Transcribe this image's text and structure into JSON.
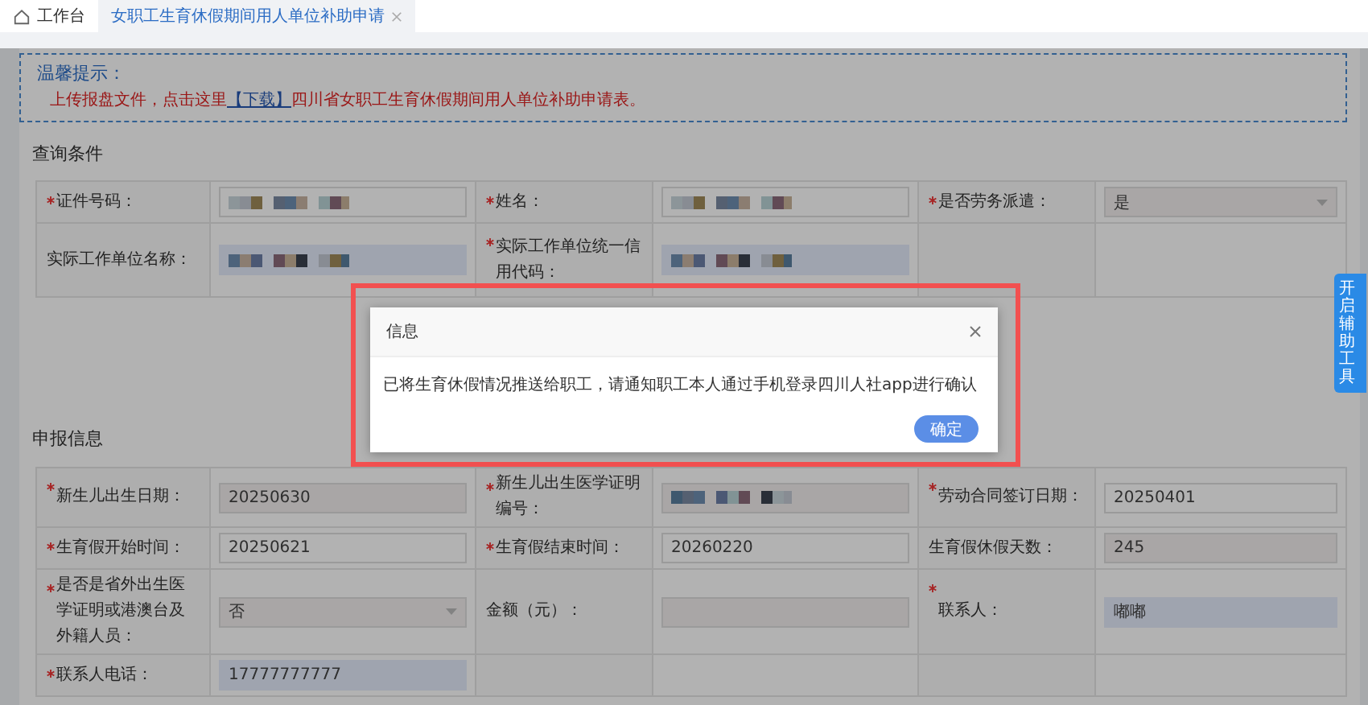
{
  "tabs": [
    {
      "label": "工作台",
      "kind": "home",
      "selected": false,
      "closable": false
    },
    {
      "label": "女职工生育休假期间用人单位补助申请",
      "kind": "page",
      "selected": true,
      "closable": true
    }
  ],
  "notice": {
    "title": "温馨提示：",
    "text_before": "上传报盘文件，点击这里",
    "link": "【下载】",
    "text_after": "四川省女职工生育休假期间用人单位补助申请表。"
  },
  "query_section": {
    "title": "查询条件",
    "rows": [
      [
        {
          "label": "证件号码：",
          "required": true,
          "kind": "blurred",
          "disabled": false,
          "highlighted": false
        },
        {
          "label": "姓名：",
          "required": true,
          "kind": "blurred",
          "disabled": false,
          "highlighted": false
        },
        {
          "label": "是否劳务派遣：",
          "required": true,
          "kind": "select",
          "value": "是",
          "disabled": true,
          "highlighted": false
        }
      ],
      [
        {
          "label": "实际工作单位名称：",
          "required": false,
          "kind": "blurred",
          "disabled": false,
          "highlighted": true
        },
        {
          "label": "实际工作单位统一信用代码：",
          "required": true,
          "kind": "blurred",
          "disabled": false,
          "highlighted": true
        }
      ]
    ]
  },
  "report_section": {
    "title": "申报信息",
    "rows": [
      [
        {
          "label": "新生儿出生日期：",
          "required": true,
          "kind": "input",
          "value": "20250630",
          "disabled": true,
          "highlighted": false
        },
        {
          "label": "新生儿出生医学证明编号：",
          "required": true,
          "kind": "blurred",
          "disabled": true,
          "highlighted": false
        },
        {
          "label": "劳动合同签订日期：",
          "required": true,
          "kind": "input",
          "value": "20250401",
          "disabled": false,
          "highlighted": false
        }
      ],
      [
        {
          "label": "生育假开始时间：",
          "required": true,
          "kind": "input",
          "value": "20250621",
          "disabled": false,
          "highlighted": false
        },
        {
          "label": "生育假结束时间：",
          "required": true,
          "kind": "input",
          "value": "20260220",
          "disabled": false,
          "highlighted": false
        },
        {
          "label": "生育假休假天数：",
          "required": false,
          "kind": "input",
          "value": "245",
          "disabled": true,
          "highlighted": false
        }
      ],
      [
        {
          "label": "是否是省外出生医学证明或港澳台及外籍人员：",
          "required": true,
          "kind": "select",
          "value": "否",
          "disabled": true,
          "highlighted": false
        },
        {
          "label": "金额（元）：",
          "required": false,
          "kind": "input",
          "disabled": true,
          "highlighted": false
        },
        {
          "label": "联系人：",
          "required": true,
          "kind": "input",
          "value": "嘟嘟",
          "disabled": false,
          "highlighted": true
        }
      ],
      [
        {
          "label": "联系人电话：",
          "required": true,
          "kind": "input",
          "value": "17777777777",
          "disabled": false,
          "highlighted": true
        }
      ]
    ]
  },
  "side_tab": {
    "label": "开启辅助工具"
  },
  "dialog": {
    "title": "信息",
    "message": "已将生育休假情况推送给职工，请通知职工本人通过手机登录四川人社app进行确认",
    "button": "确定"
  }
}
